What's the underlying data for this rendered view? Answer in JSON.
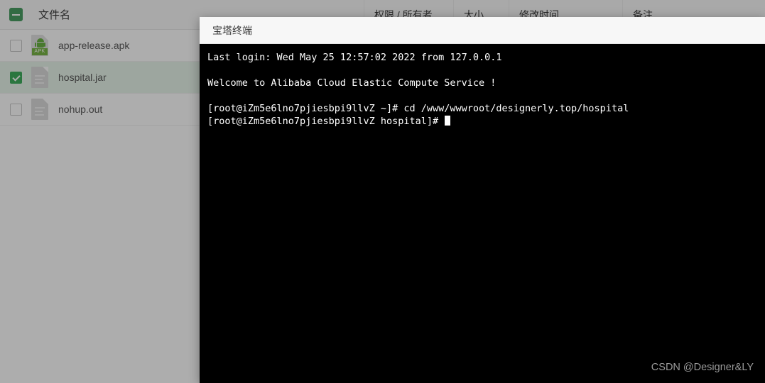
{
  "file_manager": {
    "header": {
      "select_all_state": "indeterminate",
      "columns": [
        {
          "key": "name",
          "label": "文件名"
        },
        {
          "key": "permission",
          "label": "权限 / 所有者"
        },
        {
          "key": "size",
          "label": "大小"
        },
        {
          "key": "modified",
          "label": "修改时间"
        },
        {
          "key": "note",
          "label": "备注"
        }
      ]
    },
    "rows": [
      {
        "checked": false,
        "icon": "apk-file-icon",
        "icon_badge": "APK",
        "name": "app-release.apk",
        "permission": "",
        "size": "",
        "modified": "",
        "note": ""
      },
      {
        "checked": true,
        "icon": "generic-file-icon",
        "icon_badge": "",
        "name": "hospital.jar",
        "permission": "",
        "size": "",
        "modified": "",
        "note": ""
      },
      {
        "checked": false,
        "icon": "generic-file-icon",
        "icon_badge": "",
        "name": "nohup.out",
        "permission": "",
        "size": "",
        "modified": "",
        "note": ""
      }
    ]
  },
  "terminal": {
    "title": "宝塔终端",
    "lines": [
      "Last login: Wed May 25 12:57:02 2022 from 127.0.0.1",
      "",
      "Welcome to Alibaba Cloud Elastic Compute Service !",
      "",
      "[root@iZm5e6lno7pjiesbpi9llvZ ~]# cd /www/wwwroot/designerly.top/hospital",
      "[root@iZm5e6lno7pjiesbpi9llvZ hospital]# "
    ],
    "cursor_visible": true,
    "background_color": "#000000",
    "text_color": "#ffffff"
  },
  "watermark": {
    "text": "CSDN @Designer&LY"
  },
  "theme": {
    "accent_green": "#3eaf5e",
    "selected_row": "#e8f5ea",
    "backdrop": "rgba(0,0,0,0.32)"
  }
}
